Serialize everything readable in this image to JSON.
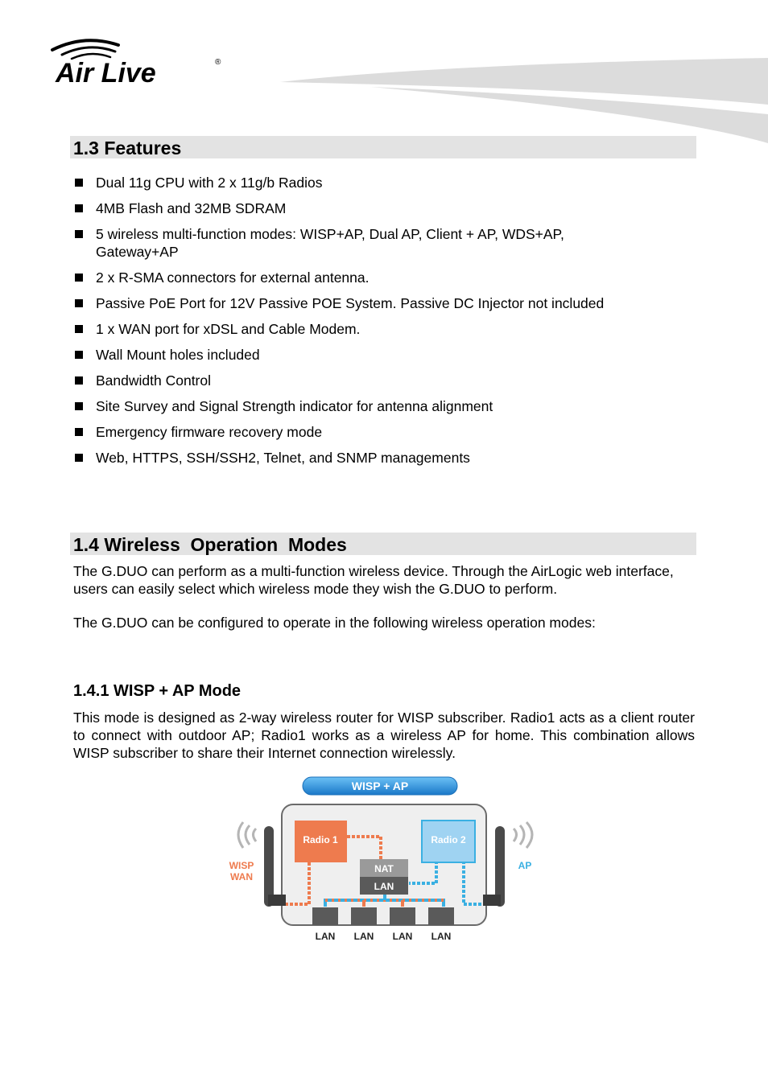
{
  "header": {
    "brand": "Air Live",
    "registered_mark": "®"
  },
  "section_1_3": {
    "title": "1.3 Features",
    "bullet_icon": "square-bullet",
    "items": [
      "Dual 11g CPU with 2 x 11g/b Radios",
      "4MB Flash and 32MB SDRAM",
      "5 wireless multi-function modes:   WISP+AP, Dual AP, Client + AP, WDS+AP, Gateway+AP",
      "2 x R-SMA connectors for external antenna.",
      "Passive PoE Port for 12V Passive POE System.   Passive DC Injector not included",
      "1 x WAN port for xDSL and Cable Modem.",
      "Wall Mount holes included",
      "Bandwidth Control",
      "Site Survey and Signal Strength indicator for antenna alignment",
      "Emergency firmware recovery mode",
      "Web, HTTPS, SSH/SSH2, Telnet, and SNMP managements"
    ]
  },
  "section_1_4": {
    "title": "1.4 Wireless  Operation  Modes",
    "para1": "The G.DUO can perform as a multi-function wireless device.   Through the AirLogic web interface, users can easily select which wireless mode they wish the G.DUO to perform.",
    "para2": "The G.DUO can be configured to operate in the following wireless operation modes:",
    "sub_1_4_1": {
      "title": "1.4.1 WISP + AP Mode",
      "body": "This mode is designed as 2-way wireless router for WISP subscriber.   Radio1 acts as a client router to connect with outdoor AP; Radio1 works as a wireless AP for home.   This combination allows WISP subscriber to share their Internet connection wirelessly."
    }
  },
  "diagram": {
    "banner": "WISP + AP",
    "radio1": "Radio 1",
    "radio2": "Radio 2",
    "nat": "NAT",
    "lan_block": "LAN",
    "left_label_1": "WISP",
    "left_label_2": "WAN",
    "right_label": "AP",
    "ports": [
      "LAN",
      "LAN",
      "LAN",
      "LAN"
    ],
    "colors": {
      "wan": "#ee7b4e",
      "ap": "#3ab0e2",
      "radio2_fill": "#9fd3f2",
      "banner": "#2c8fd6"
    }
  }
}
